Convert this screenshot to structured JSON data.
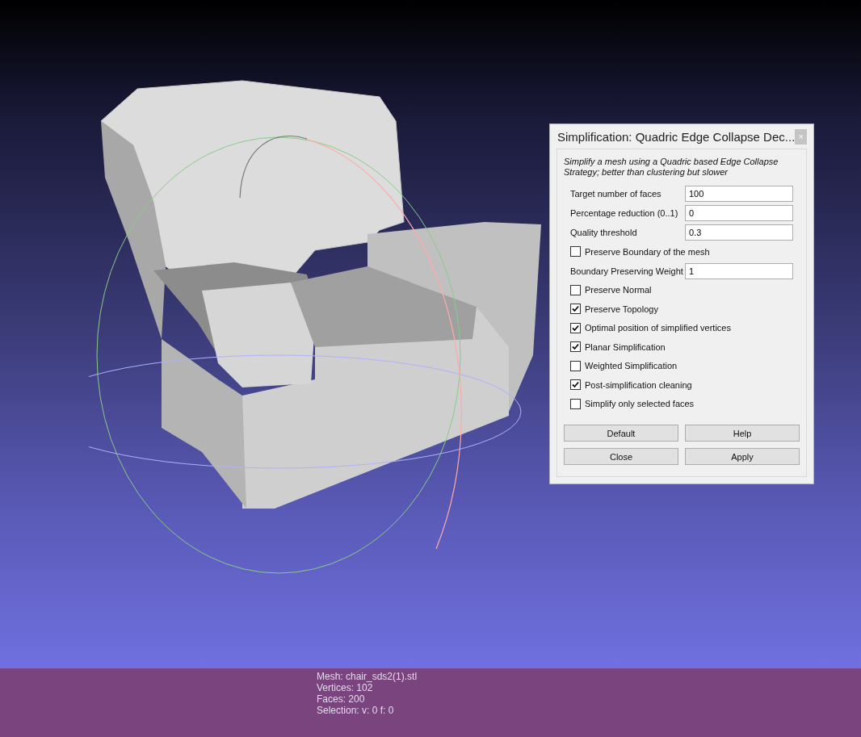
{
  "dialog": {
    "title": "Simplification: Quadric Edge Collapse Dec...",
    "close": "×",
    "description": "Simplify a mesh using a Quadric based Edge Collapse Strategy; better than clustering but slower",
    "params": [
      {
        "kind": "number",
        "label": "Target number of faces",
        "value": "100"
      },
      {
        "kind": "number",
        "label": "Percentage reduction (0..1)",
        "value": "0"
      },
      {
        "kind": "number",
        "label": "Quality threshold",
        "value": "0.3"
      },
      {
        "kind": "checkbox",
        "label": "Preserve Boundary of the mesh",
        "checked": false
      },
      {
        "kind": "number",
        "label": "Boundary Preserving Weight",
        "value": "1"
      },
      {
        "kind": "checkbox",
        "label": "Preserve Normal",
        "checked": false
      },
      {
        "kind": "checkbox",
        "label": "Preserve Topology",
        "checked": true
      },
      {
        "kind": "checkbox",
        "label": "Optimal position of simplified vertices",
        "checked": true
      },
      {
        "kind": "checkbox",
        "label": "Planar Simplification",
        "checked": true
      },
      {
        "kind": "checkbox",
        "label": "Weighted Simplification",
        "checked": false
      },
      {
        "kind": "checkbox",
        "label": "Post-simplification cleaning",
        "checked": true
      },
      {
        "kind": "checkbox",
        "label": "Simplify only selected faces",
        "checked": false
      }
    ],
    "buttons": [
      "Default",
      "Help",
      "Close",
      "Apply"
    ]
  },
  "info": [
    "Mesh: chair_sds2(1).stl",
    "Vertices: 102",
    "Faces: 200",
    "Selection: v: 0 f: 0"
  ]
}
